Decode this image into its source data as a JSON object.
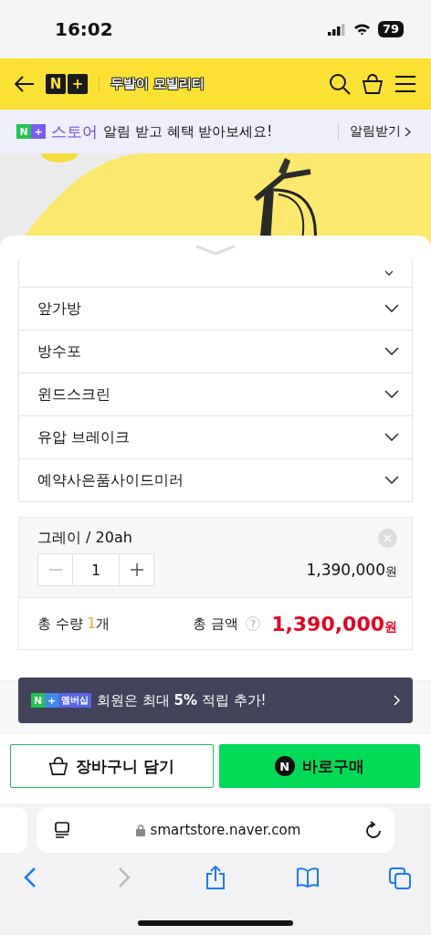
{
  "status_bar": {
    "time": "16:02",
    "battery": "79"
  },
  "header": {
    "logo": [
      "N",
      "+"
    ],
    "store_name": "두발이 모빌리티"
  },
  "notice_banner": {
    "logo": [
      "N",
      "+"
    ],
    "brand": "스토어",
    "message": "알림 받고 혜택 받아보세요!",
    "action": "알림받기"
  },
  "options": [
    {
      "label": "앞가방",
      "expanded": false
    },
    {
      "label": "방수포",
      "expanded": false
    },
    {
      "label": "윈드스크린",
      "expanded": false
    },
    {
      "label": "유압 브레이크",
      "expanded": false
    },
    {
      "label": "예약사은품사이드미러",
      "expanded": false
    }
  ],
  "selected_option": {
    "name": "그레이 / 20ah",
    "quantity": "1",
    "price": "1,390,000",
    "currency": "원"
  },
  "total": {
    "quantity_prefix": "총 수량",
    "quantity": "1",
    "quantity_suffix": "개",
    "amount_label": "총 금액",
    "help": "?",
    "amount": "1,390,000",
    "currency": "원"
  },
  "membership_toast": {
    "logo": [
      "N",
      "+"
    ],
    "badge": "멤버십",
    "message": "회원은 최대 **5%** 적립 추가!"
  },
  "buttons": [
    {
      "kind": "cart",
      "label": "장바구니 담기"
    },
    {
      "kind": "buy",
      "label": "바로구매",
      "icon_text": "N"
    }
  ],
  "browser": {
    "url": "smartstore.naver.com",
    "back_enabled": true,
    "forward_enabled": false
  }
}
